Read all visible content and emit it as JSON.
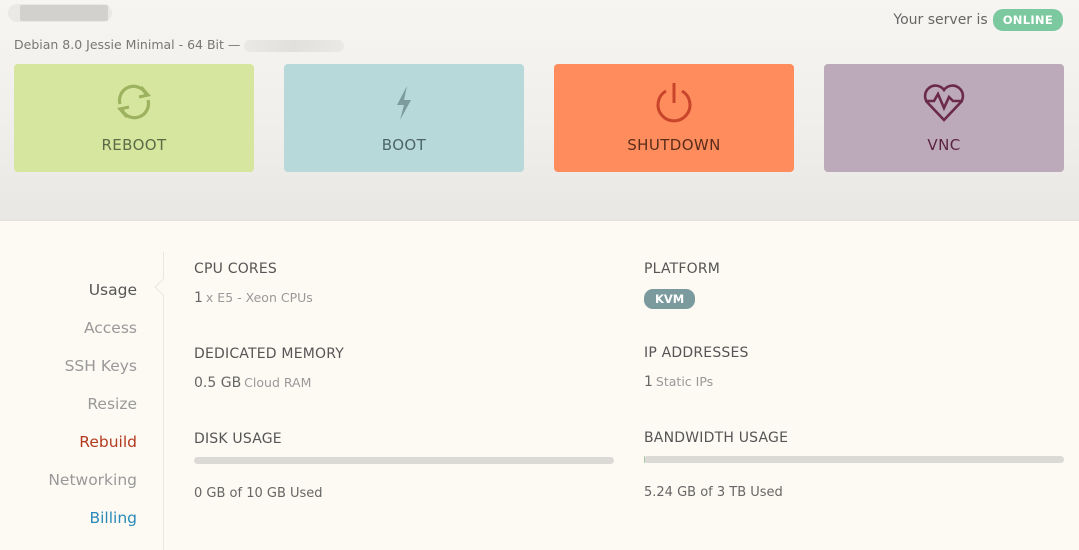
{
  "header": {
    "os_line": "Debian 8.0 Jessie Minimal - 64 Bit —",
    "status_text": "Your server is",
    "status_badge": "ONLINE",
    "status_color": "#7cc9a0"
  },
  "actions": [
    {
      "label": "REBOOT",
      "icon": "refresh-icon",
      "color": "#d7e69e"
    },
    {
      "label": "BOOT",
      "icon": "lightning-icon",
      "color": "#b7d9da"
    },
    {
      "label": "SHUTDOWN",
      "icon": "power-icon",
      "color": "#ff8c5c"
    },
    {
      "label": "VNC",
      "icon": "heart-monitor-icon",
      "color": "#bca9ba"
    }
  ],
  "nav": {
    "items": [
      {
        "label": "Usage"
      },
      {
        "label": "Access"
      },
      {
        "label": "SSH Keys"
      },
      {
        "label": "Resize"
      },
      {
        "label": "Rebuild"
      },
      {
        "label": "Networking"
      },
      {
        "label": "Billing"
      }
    ],
    "active_index": 0
  },
  "stats": {
    "cpu": {
      "title": "CPU CORES",
      "value": "1",
      "unit": "x E5 - Xeon CPUs"
    },
    "memory": {
      "title": "DEDICATED MEMORY",
      "value": "0.5 GB",
      "unit": "Cloud RAM"
    },
    "disk": {
      "title": "DISK USAGE",
      "caption": "0 GB of 10 GB Used",
      "fraction": 0.0
    },
    "platform": {
      "title": "PLATFORM",
      "badge": "KVM"
    },
    "ip": {
      "title": "IP ADDRESSES",
      "value": "1",
      "unit": "Static IPs"
    },
    "bandwidth": {
      "title": "BANDWIDTH USAGE",
      "caption": "5.24 GB of 3 TB Used",
      "fraction": 0.0017
    }
  }
}
